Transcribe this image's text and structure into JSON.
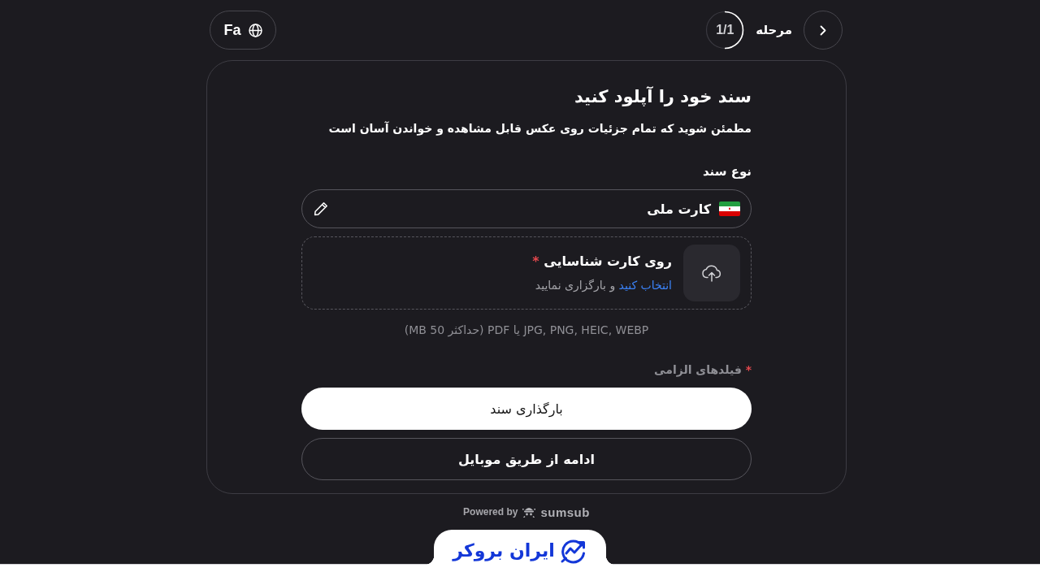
{
  "header": {
    "language_button": {
      "label": "Fa"
    },
    "step": {
      "label": "مرحله",
      "counter": "1/1",
      "level": 0.5
    }
  },
  "card": {
    "title": "سند خود را آپلود کنید",
    "subtitle": "مطمئن شوید که تمام جزئیات روی عکس قابل مشاهده و خواندن آسان است",
    "document_type": {
      "label": "نوع سند",
      "value": "کارت ملی"
    },
    "upload": {
      "title": "روی کارت شناسایی",
      "required_mark": "*",
      "link": "انتخاب کنید",
      "text": "و بارگزاری نمایید"
    },
    "formats_note": "JPG, PNG, HEIC, WEBP یا PDF (حداکثر 50 MB)",
    "required_note": {
      "mark": "*",
      "text": "فیلدهای الزامی"
    },
    "buttons": [
      {
        "label": "بارگذاری سند",
        "kind": "primary"
      },
      {
        "label": "ادامه از طریق موبایل",
        "kind": "secondary"
      }
    ]
  },
  "footer": {
    "powered_by": "Powered by",
    "brand": "sumsub"
  },
  "bottom_bar": {
    "logo_text": "ایران بروکر"
  }
}
